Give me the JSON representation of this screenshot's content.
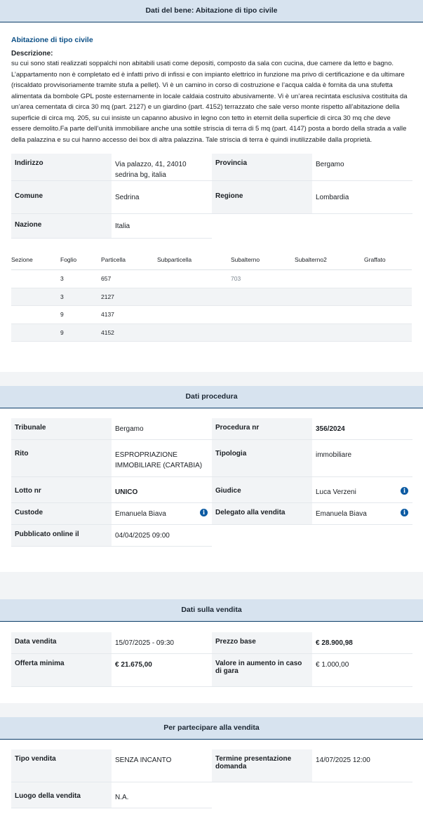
{
  "bene": {
    "header": "Dati del bene: Abitazione di tipo civile",
    "title": "Abitazione di tipo civile",
    "desc_label": "Descrizione:",
    "description": "su cui sono stati realizzati soppalchi non abitabili usati come depositi, composto da sala con cucina, due camere da letto e bagno. L’appartamento non è completato ed è infatti privo di infissi e con impianto elettrico in funzione ma privo di certificazione e da ultimare (riscaldato provvisoriamente tramite stufa a pellet). Vi è un camino in corso di costruzione e l’acqua calda è fornita da una stufetta alimentata da bombole GPL poste esternamente in locale caldaia costruito abusivamente. Vi è un’area recintata esclusiva costituita da un’area cementata di circa 30 mq (part. 2127) e un giardino (part. 4152) terrazzato che sale verso monte rispetto all’abitazione della superficie di circa mq. 205, su cui insiste un capanno abusivo in legno con tetto in eternit della superficie di circa 30 mq che deve essere demolito.Fa parte dell’unità immobiliare anche una sottile striscia di terra di 5 mq (part. 4147) posta a bordo della strada a valle della palazzina e su cui hanno accesso dei box di altra palazzina. Tale striscia di terra è quindi inutilizzabile dalla proprietà.",
    "indirizzo_label": "Indirizzo",
    "indirizzo_line1": "Via palazzo, 41, 24010",
    "indirizzo_line2": "sedrina bg, italia",
    "provincia_label": "Provincia",
    "provincia": "Bergamo",
    "comune_label": "Comune",
    "comune": "Sedrina",
    "regione_label": "Regione",
    "regione": "Lombardia",
    "nazione_label": "Nazione",
    "nazione": "Italia"
  },
  "catasto": {
    "headers": [
      "Sezione",
      "Foglio",
      "Particella",
      "Subparticella",
      "Subalterno",
      "Subalterno2",
      "Graffato"
    ],
    "rows": [
      [
        "",
        "3",
        "657",
        "",
        "703",
        "",
        ""
      ],
      [
        "",
        "3",
        "2127",
        "",
        "",
        "",
        ""
      ],
      [
        "",
        "9",
        "4137",
        "",
        "",
        "",
        ""
      ],
      [
        "",
        "9",
        "4152",
        "",
        "",
        "",
        ""
      ]
    ]
  },
  "procedura": {
    "header": "Dati procedura",
    "tribunale_label": "Tribunale",
    "tribunale": "Bergamo",
    "procedura_label": "Procedura nr",
    "procedura": "356/2024",
    "rito_label": "Rito",
    "rito_line1": "ESPROPRIAZIONE",
    "rito_line2": "IMMOBILIARE (CARTABIA)",
    "tipologia_label": "Tipologia",
    "tipologia": "immobiliare",
    "lotto_label": "Lotto nr",
    "lotto": "UNICO",
    "giudice_label": "Giudice",
    "giudice": "Luca Verzeni",
    "custode_label": "Custode",
    "custode": "Emanuela Biava",
    "delegato_label": "Delegato alla vendita",
    "delegato": "Emanuela Biava",
    "pubblicato_label": "Pubblicato online il",
    "pubblicato": "04/04/2025 09:00",
    "info_glyph": "i"
  },
  "vendita": {
    "header": "Dati sulla vendita",
    "data_label": "Data vendita",
    "data": "15/07/2025 - 09:30",
    "prezzo_label": "Prezzo base",
    "prezzo": "€ 28.900,98",
    "offerta_label": "Offerta minima",
    "offerta": "€ 21.675,00",
    "aumento_label_line1": "Valore in aumento in caso",
    "aumento_label_line2": "di gara",
    "aumento": "€ 1.000,00"
  },
  "partecipare": {
    "header": "Per partecipare alla vendita",
    "tipo_label": "Tipo vendita",
    "tipo": "SENZA INCANTO",
    "termine_label_line1": "Termine presentazione",
    "termine_label_line2": "domanda",
    "termine": "14/07/2025 12:00",
    "luogo_label": "Luogo della vendita",
    "luogo": "N.A."
  },
  "colors": {
    "header_bg": "#d7e3ef",
    "header_border": "#0b3c68",
    "title_blue": "#0b4f86",
    "label_bg": "#f2f4f6",
    "info_icon": "#0b5aa2"
  },
  "icons": {
    "info": "info-circle-icon"
  }
}
